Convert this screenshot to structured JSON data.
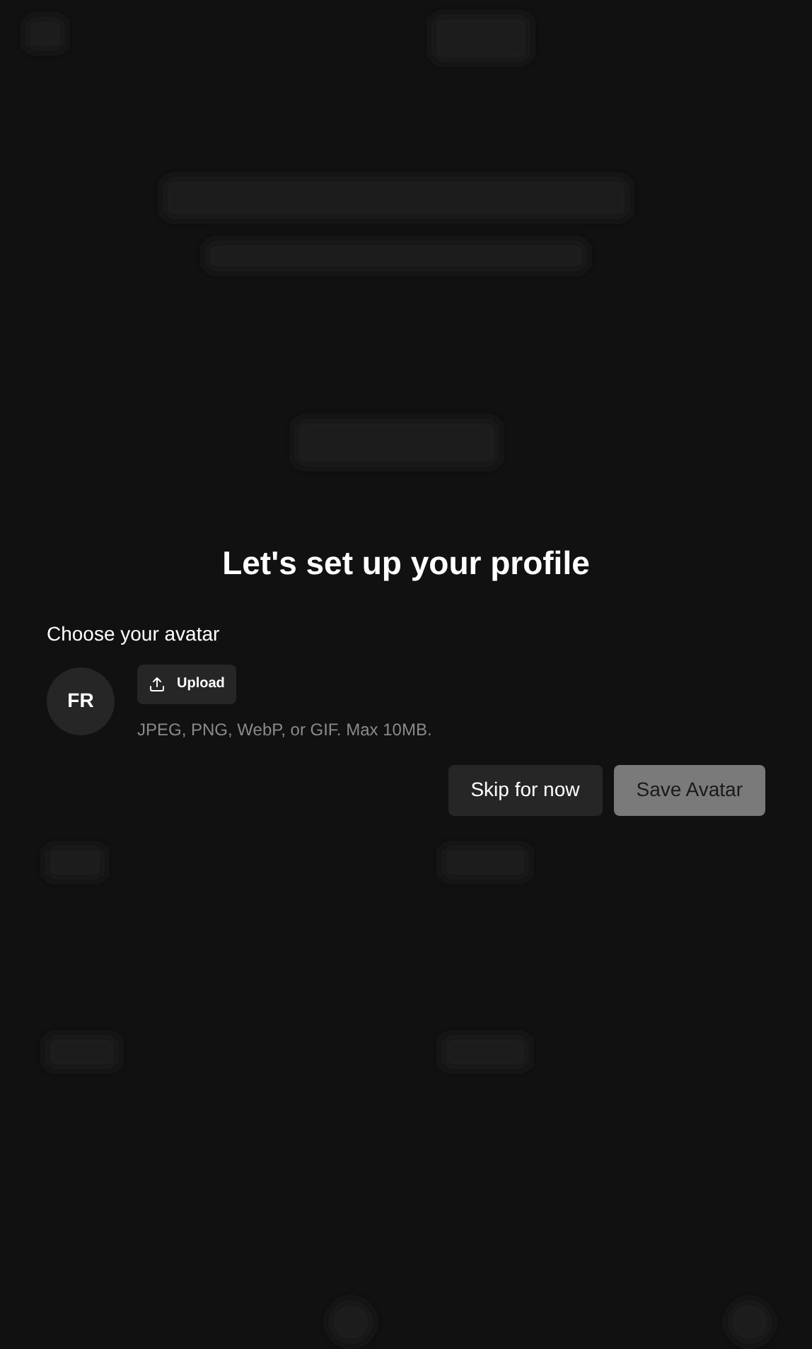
{
  "dialog": {
    "title": "Let's set up your profile",
    "avatar_label": "Choose your avatar",
    "avatar": {
      "initials": "FR"
    },
    "upload_button": {
      "label": "Upload"
    },
    "hint": "JPEG, PNG, WebP, or GIF. Max 10MB.",
    "buttons": [
      {
        "label": "Skip for now",
        "disabled": false
      },
      {
        "label": "Save Avatar",
        "disabled": true
      }
    ]
  }
}
